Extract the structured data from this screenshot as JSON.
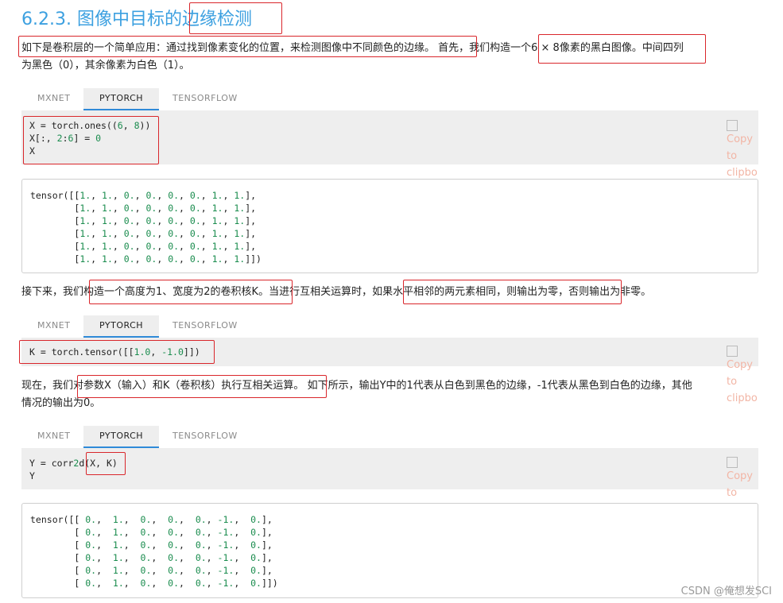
{
  "title": "6.2.3. 图像中目标的边缘检测",
  "tabs": [
    "MXNET",
    "PYTORCH",
    "TENSORFLOW"
  ],
  "para1": {
    "line1": "如下是卷积层的一个简单应用：通过找到像素变化的位置，来检测图像中不同颜色的边缘。 首先，我们构造一个6 × 8像素的黑白图像。中间四列",
    "line2": "为黑色（0），其余像素为白色（1）。"
  },
  "code1": [
    "X = torch.ones((6, 8))",
    "X[:, 2:6] = 0",
    "X"
  ],
  "output1": [
    "tensor([[1., 1., 0., 0., 0., 0., 1., 1.],",
    "        [1., 1., 0., 0., 0., 0., 1., 1.],",
    "        [1., 1., 0., 0., 0., 0., 1., 1.],",
    "        [1., 1., 0., 0., 0., 0., 1., 1.],",
    "        [1., 1., 0., 0., 0., 0., 1., 1.],",
    "        [1., 1., 0., 0., 0., 0., 1., 1.]])"
  ],
  "para2": "接下来，我们构造一个高度为1、宽度为2的卷积核K。当进行互相关运算时，如果水平相邻的两元素相同，则输出为零，否则输出为非零。",
  "code2": [
    "K = torch.tensor([[1.0, -1.0]])"
  ],
  "para3": {
    "line1": "现在，我们对参数X（输入）和K（卷积核）执行互相关运算。 如下所示，输出Y中的1代表从白色到黑色的边缘，-1代表从黑色到白色的边缘，其他",
    "line2": "情况的输出为0。"
  },
  "code3": [
    "Y = corr2d(X, K)",
    "Y"
  ],
  "output3": [
    "tensor([[ 0.,  1.,  0.,  0.,  0., -1.,  0.],",
    "        [ 0.,  1.,  0.,  0.,  0., -1.,  0.],",
    "        [ 0.,  1.,  0.,  0.,  0., -1.,  0.],",
    "        [ 0.,  1.,  0.,  0.,  0., -1.,  0.],",
    "        [ 0.,  1.,  0.,  0.,  0., -1.,  0.],",
    "        [ 0.,  1.,  0.,  0.,  0., -1.,  0.]])"
  ],
  "copy_label": [
    "Copy",
    "to",
    "clipbo"
  ],
  "watermark": "CSDN @俺想发SCI",
  "colors": {
    "title": "#3ca0e0",
    "tab_underline": "#2f8ad8",
    "annotation": "#d9262b",
    "number": "#1a8c4e"
  }
}
